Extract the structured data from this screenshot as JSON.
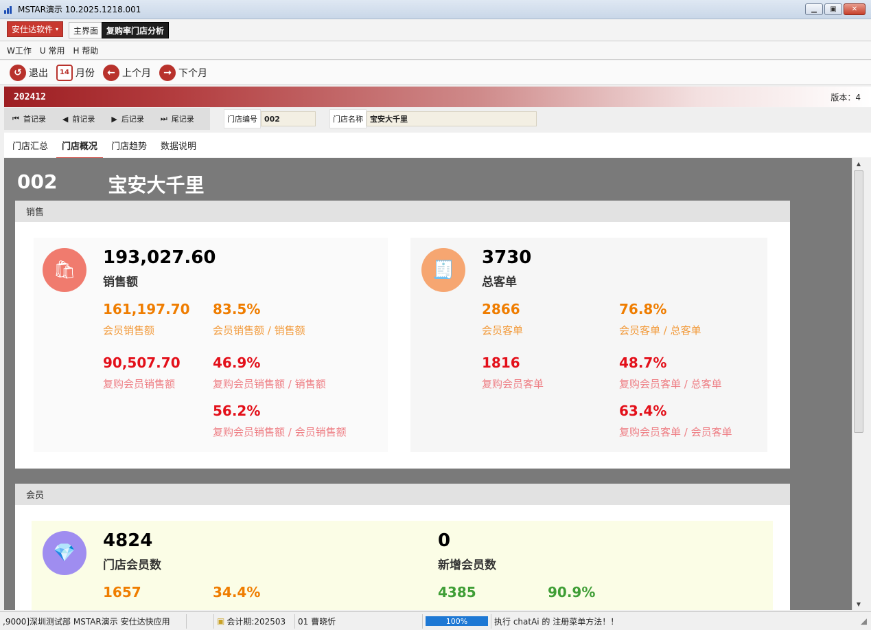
{
  "window": {
    "title": "MSTAR演示    10.2025.1218.001"
  },
  "tabbar": {
    "brand": "安仕达软件",
    "tabs": [
      "主界面",
      "复购率门店分析"
    ]
  },
  "menu": [
    "W工作",
    "U 常用",
    "H 帮助"
  ],
  "toolbar": {
    "exit": "退出",
    "month": "月份",
    "month_icon_text": "14",
    "prev": "上个月",
    "next": "下个月"
  },
  "period": {
    "value": "202412",
    "version": "版本：4"
  },
  "nav": {
    "first": "首记录",
    "prev": "前记录",
    "next": "后记录",
    "last": "尾记录",
    "store_no_label": "门店编号",
    "store_no": "002",
    "store_name_label": "门店名称",
    "store_name": "宝安大千里"
  },
  "subtabs": [
    "门店汇总",
    "门店概况",
    "门店趋势",
    "数据说明"
  ],
  "store": {
    "code": "002",
    "name": "宝安大千里"
  },
  "sales": {
    "title": "销售",
    "left": {
      "total": "193,027.60",
      "total_label": "销售额",
      "m1": "161,197.70",
      "m1_label": "会员销售额",
      "r1": "83.5%",
      "r1_label": "会员销售额 / 销售额",
      "m2": "90,507.70",
      "m2_label": "复购会员销售额",
      "r2": "46.9%",
      "r2_label": "复购会员销售额 / 销售额",
      "r3": "56.2%",
      "r3_label": "复购会员销售额 / 会员销售额"
    },
    "right": {
      "total": "3730",
      "total_label": "总客单",
      "m1": "2866",
      "m1_label": "会员客单",
      "r1": "76.8%",
      "r1_label": "会员客单 / 总客单",
      "m2": "1816",
      "m2_label": "复购会员客单",
      "r2": "48.7%",
      "r2_label": "复购会员客单 / 总客单",
      "r3": "63.4%",
      "r3_label": "复购会员客单 / 会员客单"
    }
  },
  "members": {
    "title": "会员",
    "left": {
      "total": "4824",
      "total_label": "门店会员数",
      "v1": "1657",
      "v2": "34.4%"
    },
    "right": {
      "total": "0",
      "total_label": "新增会员数",
      "v1": "4385",
      "v2": "90.9%"
    }
  },
  "status": {
    "left": ",9000]深圳测试部 MSTAR演示 安仕达快应用",
    "period": "会计期:202503",
    "user": "01 曹晓忻",
    "progress": "100%",
    "progress_value": 1.0,
    "message": "执行 chatAi 的 注册菜单方法！！"
  },
  "colors": {
    "accent": "#c8382f",
    "orange": "#ef7d00",
    "red": "#e3101a",
    "green": "#3f9e36"
  }
}
